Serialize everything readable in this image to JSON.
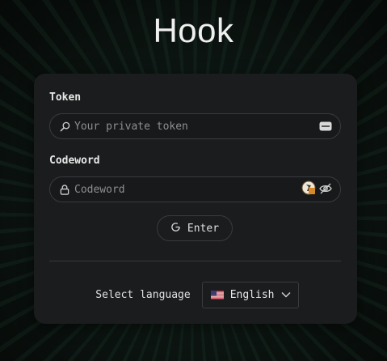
{
  "app": {
    "title": "Hook"
  },
  "form": {
    "token_label": "Token",
    "token_placeholder": "Your private token",
    "codeword_label": "Codeword",
    "codeword_placeholder": "Codeword",
    "enter_label": "Enter"
  },
  "language": {
    "label": "Select language",
    "selected": "English"
  },
  "icons": {
    "token_lead": "search-icon",
    "token_trail": "password-manager-icon",
    "codeword_lead": "lock-icon",
    "codeword_extension": "key-extension-icon",
    "codeword_toggle": "eye-off-icon",
    "enter": "refresh-icon",
    "language_flag": "us-flag-icon",
    "language_chevron": "chevron-down-icon"
  },
  "colors": {
    "background": "#0d1713",
    "card": "#1b1c1e",
    "border": "#3a3b3e",
    "text": "#e6e6e6",
    "placeholder": "#8e8f92"
  }
}
